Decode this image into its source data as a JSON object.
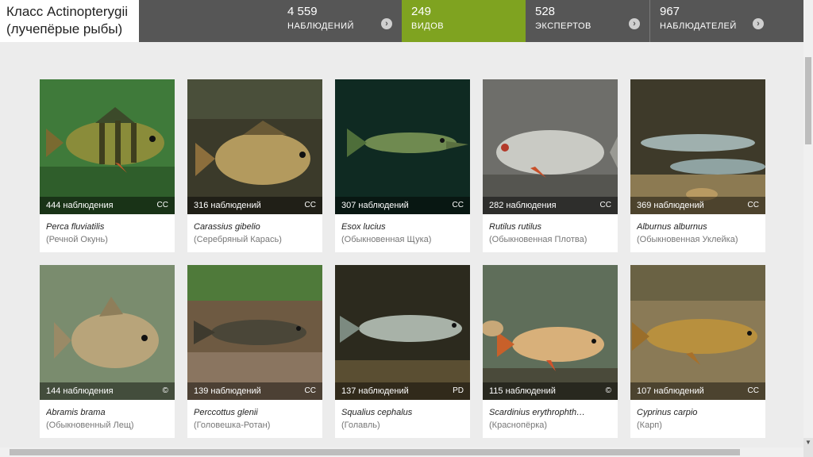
{
  "header": {
    "title_line1": "Класс Actinopterygii",
    "title_line2": "(лучепёрые рыбы)",
    "stats": [
      {
        "value": "4 559",
        "label": "НАБЛЮДЕНИЙ"
      },
      {
        "value": "249",
        "label": "ВИДОВ"
      },
      {
        "value": "528",
        "label": "ЭКСПЕРТОВ"
      },
      {
        "value": "967",
        "label": "НАБЛЮДАТЕЛЕЙ"
      }
    ],
    "accent_color": "#7fa320",
    "bar_color": "#565656"
  },
  "species": [
    {
      "observations": "444 наблюдения",
      "license": "CC",
      "scientific": "Perca fluviatilis",
      "common": "(Речной Окунь)"
    },
    {
      "observations": "316 наблюдений",
      "license": "CC",
      "scientific": "Carassius gibelio",
      "common": "(Серебряный Карась)"
    },
    {
      "observations": "307 наблюдений",
      "license": "CC",
      "scientific": "Esox lucius",
      "common": "(Обыкновенная Щука)"
    },
    {
      "observations": "282 наблюдения",
      "license": "CC",
      "scientific": "Rutilus rutilus",
      "common": "(Обыкновенная Плотва)"
    },
    {
      "observations": "369 наблюдений",
      "license": "CC",
      "scientific": "Alburnus alburnus",
      "common": "(Обыкновенная Уклейка)"
    },
    {
      "observations": "144 наблюдения",
      "license": "©",
      "scientific": "Abramis brama",
      "common": "(Обыкновенный Лещ)"
    },
    {
      "observations": "139 наблюдений",
      "license": "CC",
      "scientific": "Perccottus glenii",
      "common": "(Головешка-Ротан)"
    },
    {
      "observations": "137 наблюдений",
      "license": "PD",
      "scientific": "Squalius cephalus",
      "common": "(Голавль)"
    },
    {
      "observations": "115 наблюдений",
      "license": "©",
      "scientific": "Scardinius erythrophth…",
      "common": "(Краснопёрка)"
    },
    {
      "observations": "107 наблюдений",
      "license": "CC",
      "scientific": "Cyprinus carpio",
      "common": "(Карп)"
    }
  ]
}
